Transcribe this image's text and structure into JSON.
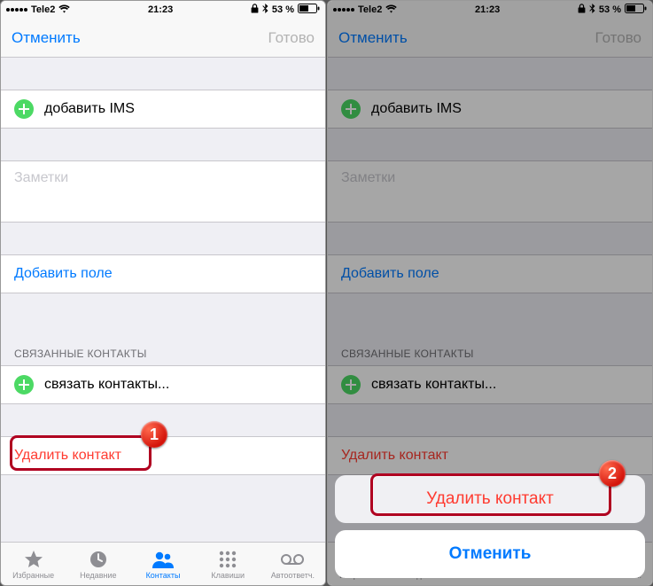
{
  "status": {
    "carrier": "Tele2",
    "time": "21:23",
    "battery": "53 %",
    "lock": "⏏",
    "bt": "bluetooth"
  },
  "nav": {
    "cancel": "Отменить",
    "done": "Готово"
  },
  "cells": {
    "add_ims": "добавить IMS",
    "notes": "Заметки",
    "add_field": "Добавить поле",
    "linked_header": "СВЯЗАННЫЕ КОНТАКТЫ",
    "link_contacts": "связать контакты...",
    "delete": "Удалить контакт"
  },
  "tabs": {
    "fav": "Избранные",
    "recent": "Недавние",
    "contacts": "Контакты",
    "keypad": "Клавиши",
    "voicemail": "Автоответч."
  },
  "sheet": {
    "delete": "Удалить контакт",
    "cancel": "Отменить"
  },
  "badges": {
    "one": "1",
    "two": "2"
  }
}
